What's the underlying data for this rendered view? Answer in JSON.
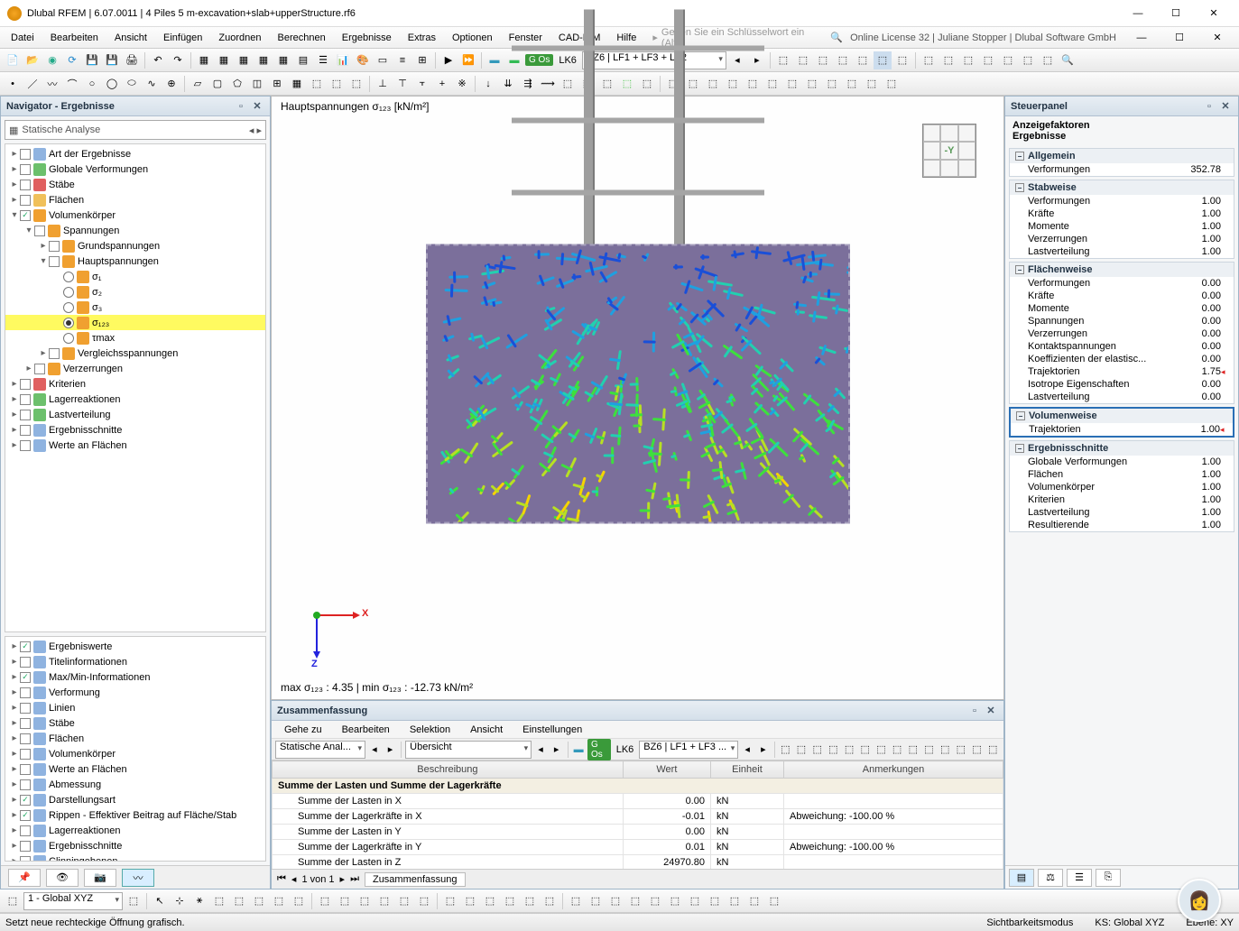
{
  "window": {
    "title": "Dlubal RFEM | 6.07.0011 | 4 Piles 5 m-excavation+slab+upperStructure.rf6",
    "min": "—",
    "max": "☐",
    "close": "✕"
  },
  "menus": [
    "Datei",
    "Bearbeiten",
    "Ansicht",
    "Einfügen",
    "Zuordnen",
    "Berechnen",
    "Ergebnisse",
    "Extras",
    "Optionen",
    "Fenster",
    "CAD-BIM",
    "Hilfe"
  ],
  "search_placeholder": "Geben Sie ein Schlüsselwort ein (Alt...",
  "license": "Online License 32 | Juliane Stopper | Dlubal Software GmbH",
  "toolbar2_combo": "BZ6 | LF1 + LF3 + LF2",
  "toolbar2_lk": "LK6",
  "navigator": {
    "title": "Navigator - Ergebnisse",
    "combo": "Statische Analyse",
    "tree": [
      {
        "lvl": 0,
        "tw": "▸",
        "cb": "",
        "ic": "ic-doc",
        "txt": "Art der Ergebnisse"
      },
      {
        "lvl": 0,
        "tw": "▸",
        "cb": "",
        "ic": "ic-bar",
        "txt": "Globale Verformungen"
      },
      {
        "lvl": 0,
        "tw": "▸",
        "cb": "",
        "ic": "ic-red",
        "txt": "Stäbe"
      },
      {
        "lvl": 0,
        "tw": "▸",
        "cb": "",
        "ic": "ic-fold",
        "txt": "Flächen"
      },
      {
        "lvl": 0,
        "tw": "▾",
        "cb": "✓",
        "ic": "ic-cube",
        "txt": "Volumenkörper"
      },
      {
        "lvl": 1,
        "tw": "▾",
        "cb": "",
        "ic": "ic-cube",
        "txt": "Spannungen"
      },
      {
        "lvl": 2,
        "tw": "▸",
        "cb": "",
        "ic": "ic-cube",
        "txt": "Grundspannungen"
      },
      {
        "lvl": 2,
        "tw": "▾",
        "cb": "",
        "ic": "ic-cube",
        "txt": "Hauptspannungen"
      },
      {
        "lvl": 3,
        "rd": "",
        "ic": "ic-cube",
        "txt": "σ₁"
      },
      {
        "lvl": 3,
        "rd": "",
        "ic": "ic-cube",
        "txt": "σ₂"
      },
      {
        "lvl": 3,
        "rd": "",
        "ic": "ic-cube",
        "txt": "σ₃"
      },
      {
        "lvl": 3,
        "rd": "on",
        "ic": "ic-cube",
        "txt": "σ₁₂₃",
        "sel": true
      },
      {
        "lvl": 3,
        "rd": "",
        "ic": "ic-cube",
        "txt": "τmax"
      },
      {
        "lvl": 2,
        "tw": "▸",
        "cb": "",
        "ic": "ic-cube",
        "txt": "Vergleichsspannungen"
      },
      {
        "lvl": 1,
        "tw": "▸",
        "cb": "",
        "ic": "ic-cube",
        "txt": "Verzerrungen"
      },
      {
        "lvl": 0,
        "tw": "▸",
        "cb": "",
        "ic": "ic-red",
        "txt": "Kriterien"
      },
      {
        "lvl": 0,
        "tw": "▸",
        "cb": "",
        "ic": "ic-bar",
        "txt": "Lagerreaktionen"
      },
      {
        "lvl": 0,
        "tw": "▸",
        "cb": "",
        "ic": "ic-bar",
        "txt": "Lastverteilung"
      },
      {
        "lvl": 0,
        "tw": "▸",
        "cb": "",
        "ic": "ic-doc",
        "txt": "Ergebnisschnitte"
      },
      {
        "lvl": 0,
        "tw": "▸",
        "cb": "",
        "ic": "ic-doc",
        "txt": "Werte an Flächen"
      }
    ],
    "tree2": [
      {
        "cb": "✓",
        "txt": "Ergebniswerte"
      },
      {
        "cb": "",
        "txt": "Titelinformationen"
      },
      {
        "cb": "✓",
        "txt": "Max/Min-Informationen"
      },
      {
        "cb": "",
        "txt": "Verformung"
      },
      {
        "cb": "",
        "txt": "Linien"
      },
      {
        "cb": "",
        "txt": "Stäbe"
      },
      {
        "cb": "",
        "txt": "Flächen"
      },
      {
        "cb": "",
        "txt": "Volumenkörper"
      },
      {
        "cb": "",
        "txt": "Werte an Flächen"
      },
      {
        "cb": "",
        "txt": "Abmessung"
      },
      {
        "cb": "✓",
        "txt": "Darstellungsart"
      },
      {
        "cb": "✓",
        "txt": "Rippen - Effektiver Beitrag auf Fläche/Stab"
      },
      {
        "cb": "",
        "txt": "Lagerreaktionen"
      },
      {
        "cb": "",
        "txt": "Ergebnisschnitte"
      },
      {
        "cb": "",
        "txt": "Clinningebenen"
      }
    ]
  },
  "viewport": {
    "label": "Hauptspannungen σ₁₂₃ [kN/m²]",
    "minmax": "max σ₁₂₃ : 4.35 | min σ₁₂₃ : -12.73 kN/m²",
    "cube": "-Y",
    "axes": {
      "x": "X",
      "z": "Z"
    }
  },
  "bottom": {
    "title": "Zusammenfassung",
    "menus": [
      "Gehe zu",
      "Bearbeiten",
      "Selektion",
      "Ansicht",
      "Einstellungen"
    ],
    "combo1": "Statische Anal...",
    "combo2": "Übersicht",
    "combo3": "BZ6 | LF1 + LF3 ...",
    "lk": "LK6",
    "headers": [
      "Beschreibung",
      "Wert",
      "Einheit",
      "Anmerkungen"
    ],
    "section": "Summe der Lasten und Summe der Lagerkräfte",
    "rows": [
      {
        "d": "Summe der Lasten in X",
        "w": "0.00",
        "e": "kN",
        "a": ""
      },
      {
        "d": "Summe der Lagerkräfte in X",
        "w": "-0.01",
        "e": "kN",
        "a": "Abweichung: -100.00 %"
      },
      {
        "d": "Summe der Lasten in Y",
        "w": "0.00",
        "e": "kN",
        "a": ""
      },
      {
        "d": "Summe der Lagerkräfte in Y",
        "w": "0.01",
        "e": "kN",
        "a": "Abweichung: -100.00 %"
      },
      {
        "d": "Summe der Lasten in Z",
        "w": "24970.80",
        "e": "kN",
        "a": ""
      }
    ],
    "footer_page": "1 von 1",
    "footer_tab": "Zusammenfassung"
  },
  "right": {
    "title": "Steuerpanel",
    "sub1": "Anzeigefaktoren",
    "sub2": "Ergebnisse",
    "groups": [
      {
        "name": "Allgemein",
        "rows": [
          {
            "l": "Verformungen",
            "v": "352.78"
          }
        ]
      },
      {
        "name": "Stabweise",
        "rows": [
          {
            "l": "Verformungen",
            "v": "1.00"
          },
          {
            "l": "Kräfte",
            "v": "1.00"
          },
          {
            "l": "Momente",
            "v": "1.00"
          },
          {
            "l": "Verzerrungen",
            "v": "1.00"
          },
          {
            "l": "Lastverteilung",
            "v": "1.00"
          }
        ]
      },
      {
        "name": "Flächenweise",
        "rows": [
          {
            "l": "Verformungen",
            "v": "0.00"
          },
          {
            "l": "Kräfte",
            "v": "0.00"
          },
          {
            "l": "Momente",
            "v": "0.00"
          },
          {
            "l": "Spannungen",
            "v": "0.00"
          },
          {
            "l": "Verzerrungen",
            "v": "0.00"
          },
          {
            "l": "Kontaktspannungen",
            "v": "0.00"
          },
          {
            "l": "Koeffizienten der elastisc...",
            "v": "0.00"
          },
          {
            "l": "Trajektorien",
            "v": "1.75",
            "red": 1
          },
          {
            "l": "Isotrope Eigenschaften",
            "v": "0.00"
          },
          {
            "l": "Lastverteilung",
            "v": "0.00"
          }
        ]
      },
      {
        "name": "Volumenweise",
        "hl": true,
        "rows": [
          {
            "l": "Trajektorien",
            "v": "1.00",
            "red": 1
          }
        ]
      },
      {
        "name": "Ergebnisschnitte",
        "rows": [
          {
            "l": "Globale Verformungen",
            "v": "1.00"
          },
          {
            "l": "Flächen",
            "v": "1.00"
          },
          {
            "l": "Volumenkörper",
            "v": "1.00"
          },
          {
            "l": "Kriterien",
            "v": "1.00"
          },
          {
            "l": "Lastverteilung",
            "v": "1.00"
          },
          {
            "l": "Resultierende",
            "v": "1.00"
          }
        ]
      }
    ]
  },
  "status": {
    "msg": "Setzt neue rechteckige Öffnung grafisch.",
    "mode": "Sichtbarkeitsmodus",
    "ks": "KS: Global XYZ",
    "ebene": "Ebene: XY",
    "combo": "1 - Global XYZ"
  }
}
